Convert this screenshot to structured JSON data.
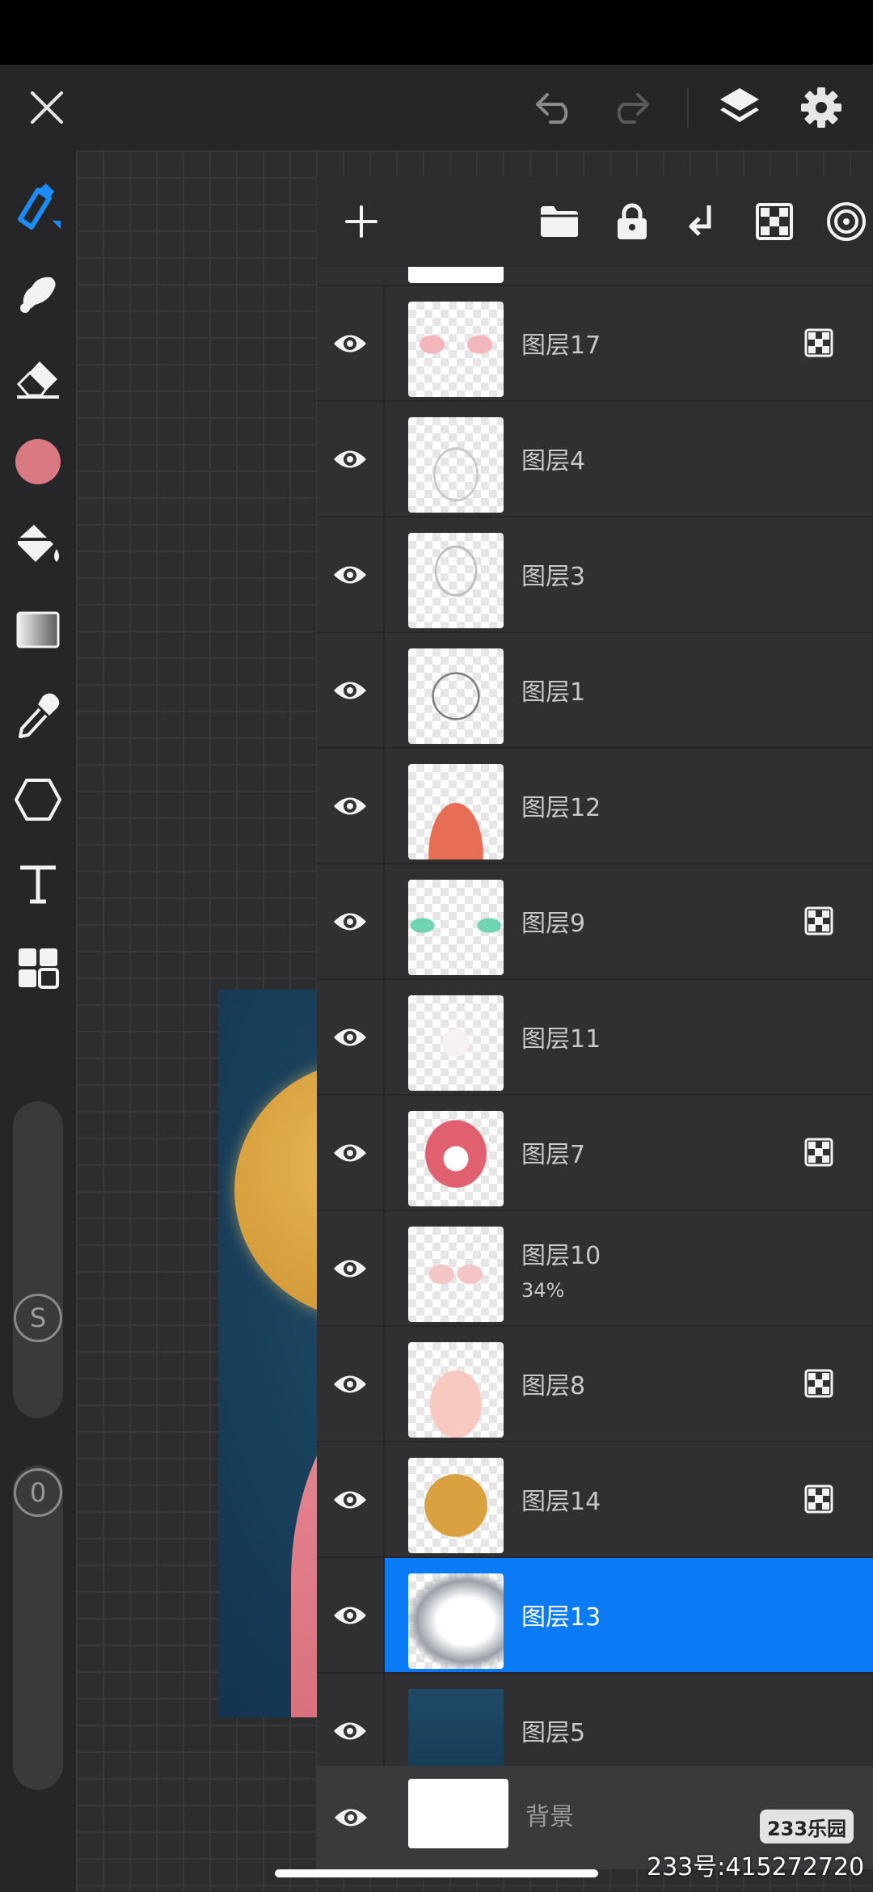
{
  "top_bar": {
    "icons": [
      "close-icon",
      "undo-icon",
      "redo-icon",
      "layers-icon",
      "settings-icon"
    ]
  },
  "tools": {
    "items": [
      "brush-icon",
      "smudge-icon",
      "eraser-icon",
      "color-swatch",
      "fill-icon",
      "gradient-icon",
      "eyedropper-icon",
      "shape-icon",
      "text-icon",
      "grid-icon"
    ],
    "current_color": "#d97a82",
    "size_label": "S",
    "opacity_label": "0"
  },
  "panel": {
    "header_icons": [
      "add-icon",
      "folder-icon",
      "lock-icon",
      "merge-down-icon",
      "alpha-lock-icon",
      "blend-icon"
    ],
    "layers": [
      {
        "name": "图层17",
        "mask": true
      },
      {
        "name": "图层4",
        "mask": false
      },
      {
        "name": "图层3",
        "mask": false
      },
      {
        "name": "图层1",
        "mask": false
      },
      {
        "name": "图层12",
        "mask": false
      },
      {
        "name": "图层9",
        "mask": true
      },
      {
        "name": "图层11",
        "mask": false
      },
      {
        "name": "图层7",
        "mask": true
      },
      {
        "name": "图层10",
        "opacity": "34%",
        "mask": false
      },
      {
        "name": "图层8",
        "mask": true
      },
      {
        "name": "图层14",
        "mask": true
      },
      {
        "name": "图层13",
        "mask": false,
        "selected": true
      },
      {
        "name": "图层5",
        "mask": false
      }
    ],
    "background_layer": "背景"
  },
  "watermark": {
    "logo": "233乐园",
    "text": "233号:415272720"
  },
  "colors": {
    "accent": "#0a7bf5",
    "toolbar_icon": "#e6e6e8"
  }
}
